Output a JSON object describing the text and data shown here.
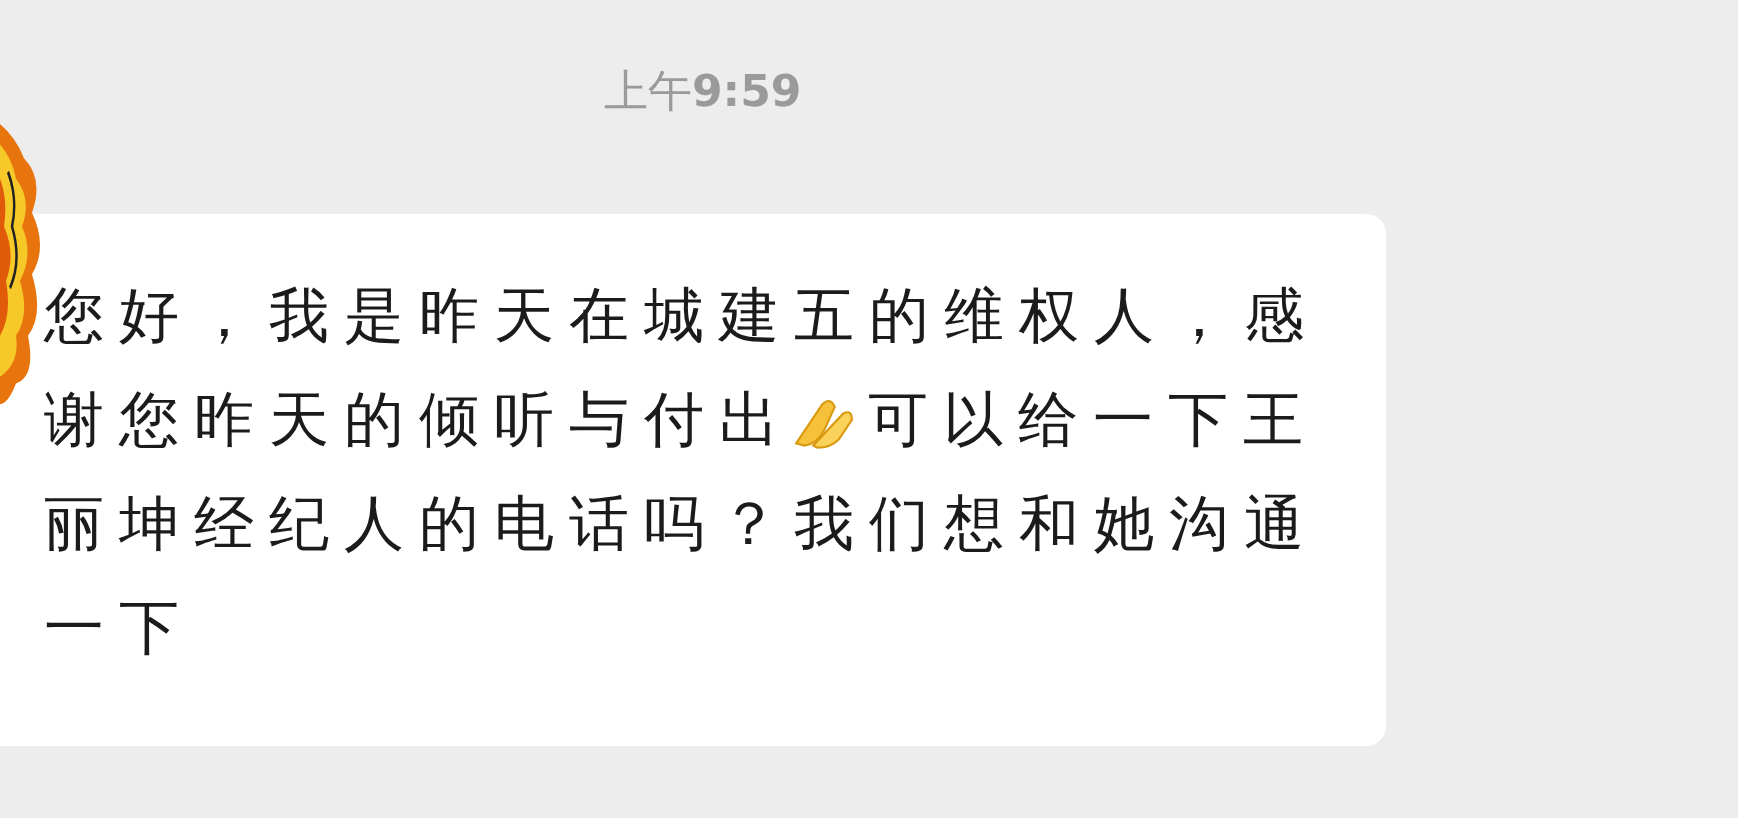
{
  "time": "上午**9:59**",
  "message": {
    "avatar": {
      "kind": "picture"
    },
    "lines": [
      [
        {
          "kind": "text",
          "text": "您好，我是昨天在城建五的维权人，感"
        }
      ],
      [
        {
          "kind": "text",
          "text": "谢您昨天的倾听与付出"
        },
        {
          "kind": "emoji"
        },
        {
          "kind": "text",
          "text": "可以给一下王"
        }
      ],
      [
        {
          "kind": "text",
          "text": "丽坤经纪人的电话吗？我们想和她沟通"
        }
      ],
      [
        {
          "kind": "text",
          "text": "一下"
        }
      ]
    ]
  }
}
